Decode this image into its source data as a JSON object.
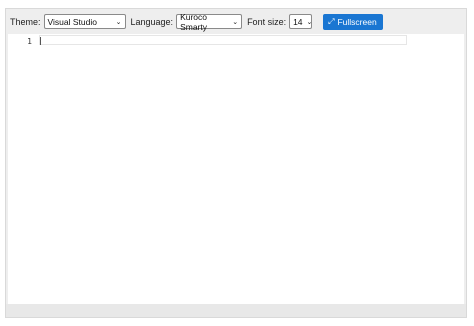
{
  "toolbar": {
    "theme_label": "Theme:",
    "theme_value": "Visual Studio",
    "language_label": "Language:",
    "language_value": "Kuroco Smarty",
    "font_size_label": "Font size:",
    "font_size_value": "14",
    "fullscreen_label": "Fullscreen",
    "fullscreen_icon": "expand-arrows-icon"
  },
  "editor": {
    "line_numbers": [
      "1"
    ],
    "content": ""
  },
  "colors": {
    "accent": "#1a76d2",
    "frame_bg": "#eeeeee",
    "editor_bg": "#ffffff"
  }
}
